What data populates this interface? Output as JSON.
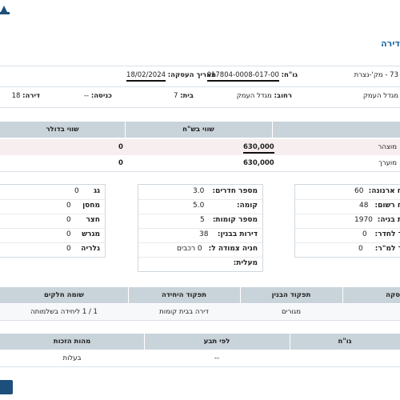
{
  "page": {
    "title": "דירה"
  },
  "info_row1": {
    "address": "73 - מק'-נצרת",
    "gush_label": "גו\"ח:",
    "gush_value": "017804-0008-017-00",
    "deal_date_label": "תאריך העסקה:",
    "deal_date_value": "18/02/2024"
  },
  "info_row2": {
    "neighborhood": "מגדל העמק",
    "street_label": "רחוב:",
    "street_value": "מגדל העמק",
    "house_label": "בית:",
    "house_value": "7",
    "entrance_label": "כניסה:",
    "entrance_value": "--",
    "apt_label": "דירה:",
    "apt_value": "18"
  },
  "value_table": {
    "headers": {
      "nis": "שווי בש\"ח",
      "usd": "שווי בדולר"
    },
    "rows": [
      {
        "label": "מוצהר",
        "nis": "630,000",
        "usd": "0"
      },
      {
        "label": "מוערך",
        "nis": "630,000",
        "usd": "0"
      }
    ]
  },
  "box_right": [
    {
      "k": "ח ארנונה:",
      "v": "60"
    },
    {
      "k": "ח רשום:",
      "v": "48"
    },
    {
      "k": "ת בניה:",
      "v": "1970"
    },
    {
      "k": "ר לחדר:",
      "v": "0"
    },
    {
      "k": "ר למ\"ר:",
      "v": "0"
    }
  ],
  "box_middle": [
    {
      "k": "מספר חדרים:",
      "v": "3.0"
    },
    {
      "k": "קומה:",
      "v": "5.0"
    },
    {
      "k": "מספר קומות:",
      "v": "5"
    },
    {
      "k": "דירות בבנין:",
      "v": "38"
    },
    {
      "k": "חניה צמודה ל:",
      "v": "0 רכבים"
    },
    {
      "k": "מעלית:",
      "v": ""
    }
  ],
  "box_left": [
    {
      "k": "גג",
      "v": "0"
    },
    {
      "k": "מחסן",
      "v": "0"
    },
    {
      "k": "חצר",
      "v": "0"
    },
    {
      "k": "מגרש",
      "v": "0"
    },
    {
      "k": "גלריה",
      "v": "0"
    }
  ],
  "use_table": {
    "headers": {
      "deal": "סקה",
      "building": "תפקוד הבנין",
      "unit": "תפקוד היחידה",
      "parts": "שומה חלקים"
    },
    "row": {
      "building": "מגורים",
      "unit": "דירה בבית קומות",
      "parts": "1 / 1 ליחידה בשלמותה"
    }
  },
  "rights_table": {
    "headers": {
      "gush": "גו\"ח",
      "by_claim": "לפי תבע",
      "rights": "מהות הזכות"
    },
    "row": {
      "by_claim": "--",
      "rights": "בעלות"
    }
  },
  "colors": {
    "accent": "#1f6aa6",
    "header_bg": "#c9d3da",
    "button": "#1d4f7c"
  }
}
